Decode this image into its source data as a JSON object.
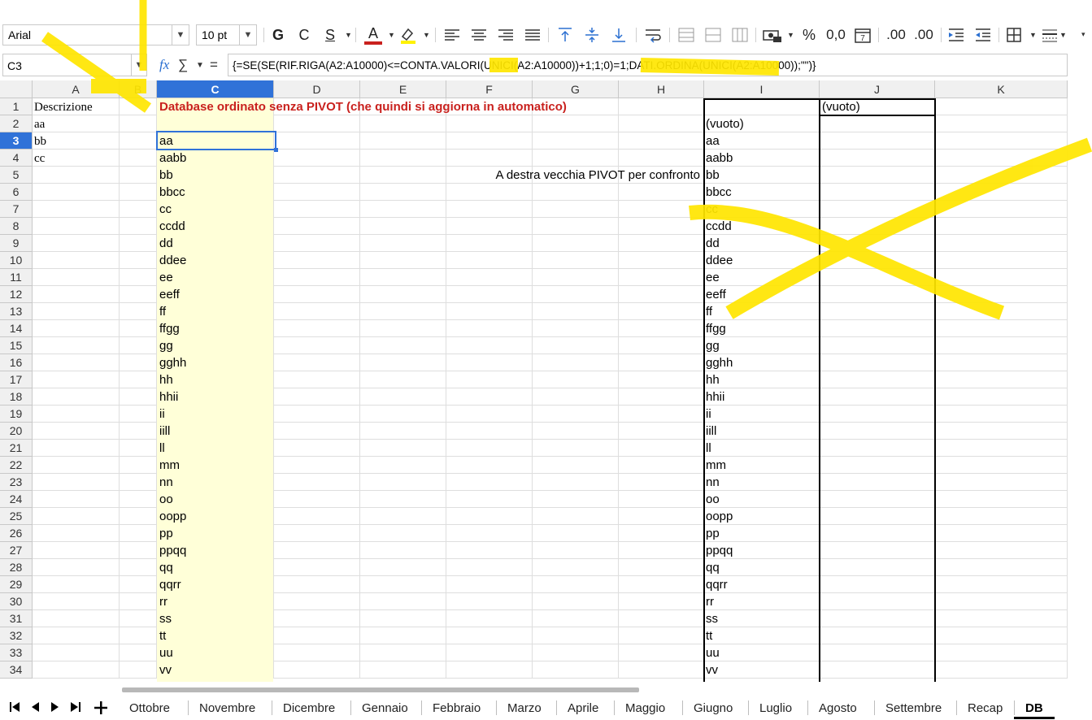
{
  "toolbar": {
    "font_name": "Arial",
    "font_size": "10 pt",
    "bold": "G",
    "italic": "C",
    "underline": "S",
    "font_color": "A",
    "percent": "%",
    "decimal": "0,0",
    "add_decimal": ".00",
    "del_decimal": ".00",
    "calendar_num": "7"
  },
  "formula_bar": {
    "cell_ref": "C3",
    "fx": "fx",
    "sigma": "∑",
    "equals": "=",
    "formula": "{=SE(SE(RIF.RIGA(A2:A10000)<=CONTA.VALORI(UNICI(A2:A10000))+1;1;0)=1;DATI.ORDINA(UNICI(A2:A10000));\"\")}"
  },
  "columns": [
    "A",
    "B",
    "C",
    "D",
    "E",
    "F",
    "G",
    "H",
    "I",
    "J",
    "K"
  ],
  "selected_column": "C",
  "rows": [
    "1",
    "2",
    "3",
    "4",
    "5",
    "6",
    "7",
    "8",
    "9",
    "10",
    "11",
    "12",
    "13",
    "14",
    "15",
    "16",
    "17",
    "18",
    "19",
    "20",
    "21",
    "22",
    "23",
    "24",
    "25",
    "26",
    "27",
    "28",
    "29",
    "30",
    "31",
    "32",
    "33",
    "34"
  ],
  "selected_row": "3",
  "col_a": [
    "Descrizione",
    "aa",
    "bb",
    "cc"
  ],
  "title_c1": "Database ordinato senza PIVOT (che quindi si aggiorna in automatico)",
  "col_c": [
    "aa",
    "aabb",
    "bb",
    "bbcc",
    "cc",
    "ccdd",
    "dd",
    "ddee",
    "ee",
    "eeff",
    "ff",
    "ffgg",
    "gg",
    "gghh",
    "hh",
    "hhii",
    "ii",
    "iill",
    "ll",
    "mm",
    "nn",
    "oo",
    "oopp",
    "pp",
    "ppqq",
    "qq",
    "qqrr",
    "rr",
    "ss",
    "tt",
    "uu",
    "vv"
  ],
  "note_f5": "A destra vecchia PIVOT per confronto",
  "pivot_j1": "(vuoto)",
  "col_i": [
    "(vuoto)",
    "aa",
    "aabb",
    "bb",
    "bbcc",
    "cc",
    "ccdd",
    "dd",
    "ddee",
    "ee",
    "eeff",
    "ff",
    "ffgg",
    "gg",
    "gghh",
    "hh",
    "hhii",
    "ii",
    "iill",
    "ll",
    "mm",
    "nn",
    "oo",
    "oopp",
    "pp",
    "ppqq",
    "qq",
    "qqrr",
    "rr",
    "ss",
    "tt",
    "uu",
    "vv"
  ],
  "sheet_tabs": [
    "Ottobre",
    "Novembre",
    "Dicembre",
    "Gennaio",
    "Febbraio",
    "Marzo",
    "Aprile",
    "Maggio",
    "Giugno",
    "Luglio",
    "Agosto",
    "Settembre",
    "Recap",
    "DB"
  ],
  "active_tab": "DB",
  "colors": {
    "accent": "#3072d8",
    "title_red": "#c9211e",
    "highlight_column": "#ffffd8",
    "annotation_yellow": "#ffe600"
  }
}
